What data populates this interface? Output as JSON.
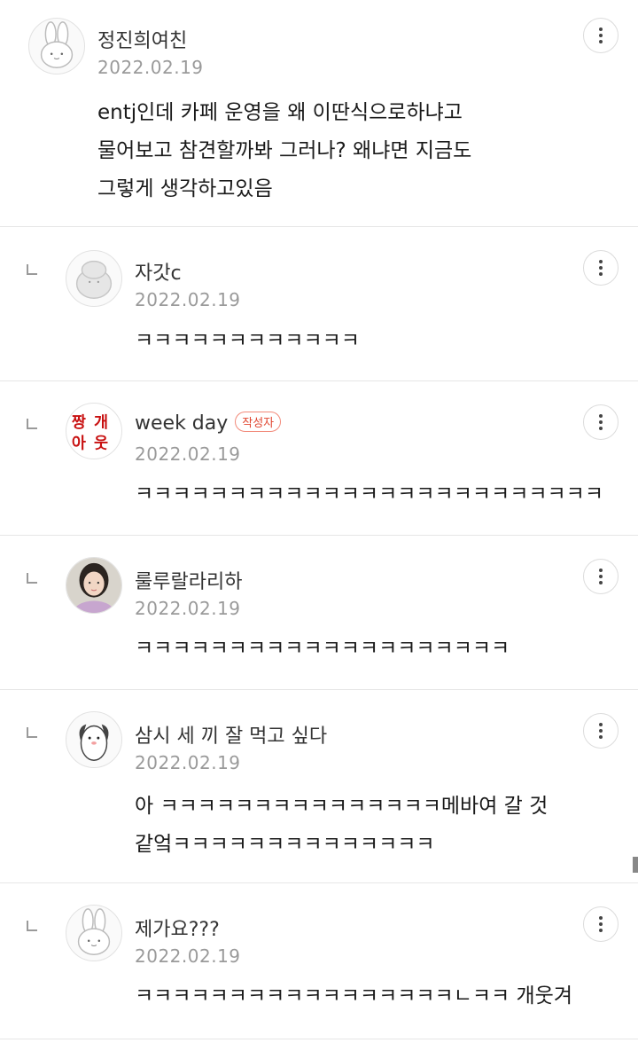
{
  "comments": [
    {
      "author": "정진희여친",
      "date": "2022.02.19",
      "text": "entj인데 카페 운영을 왜 이딴식으로하냐고\n물어보고 참견할까봐 그러나? 왜냐면 지금도\n그렇게 생각하고있음",
      "avatar_icon": "bunny-icon"
    },
    {
      "author": "자갓c",
      "date": "2022.02.19",
      "text": "ㅋㅋㅋㅋㅋㅋㅋㅋㅋㅋㅋㅋ",
      "avatar_icon": "default-character-icon"
    },
    {
      "author": "week day",
      "badge": "작성자",
      "date": "2022.02.19",
      "text": "ㅋㅋㅋㅋㅋㅋㅋㅋㅋㅋㅋㅋㅋㅋㅋㅋㅋㅋㅋㅋㅋㅋㅋㅋㅋ",
      "avatar_icon": "red-text-sticker-icon",
      "avatar_text": [
        "짱",
        "개",
        "아",
        "웃"
      ]
    },
    {
      "author": "룰루랄라리하",
      "date": "2022.02.19",
      "text": "ㅋㅋㅋㅋㅋㅋㅋㅋㅋㅋㅋㅋㅋㅋㅋㅋㅋㅋㅋㅋ",
      "avatar_icon": "profile-photo-icon"
    },
    {
      "author": "삼시 세 끼 잘 먹고 싶다",
      "date": "2022.02.19",
      "text": "아 ㅋㅋㅋㅋㅋㅋㅋㅋㅋㅋㅋㅋㅋㅋㅋ메바여 갈 것\n같엌ㅋㅋㅋㅋㅋㅋㅋㅋㅋㅋㅋㅋㅋㅋ",
      "avatar_icon": "penguin-icon"
    },
    {
      "author": "제가요???",
      "date": "2022.02.19",
      "text": "ㅋㅋㅋㅋㅋㅋㅋㅋㅋㅋㅋㅋㅋㅋㅋㅋㅋㄴㅋㅋ 개웃겨",
      "avatar_icon": "bunny-icon"
    }
  ],
  "colors": {
    "badge": "#e0452f",
    "date": "#9a9a9a",
    "divider": "#e6e6e6"
  }
}
